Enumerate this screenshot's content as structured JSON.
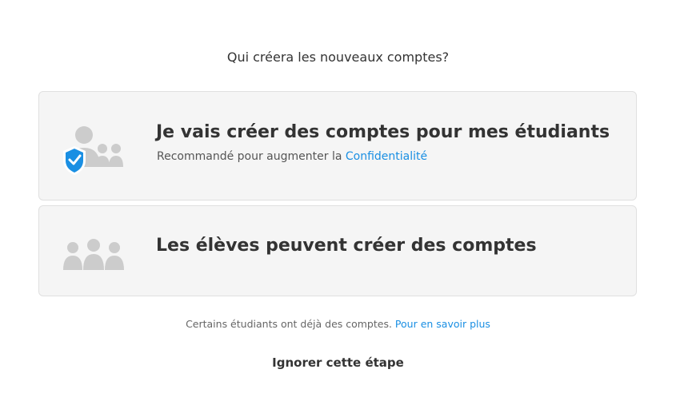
{
  "question": "Qui créera les nouveaux comptes?",
  "options": [
    {
      "title": "Je vais créer des comptes pour mes étudiants",
      "subtitle_prefix": "Recommandé pour augmenter la ",
      "subtitle_link": "Confidentialité",
      "icon": "teacher-with-shield-icon"
    },
    {
      "title": "Les élèves peuvent créer des comptes",
      "icon": "students-group-icon"
    }
  ],
  "footnote": {
    "text": "Certains étudiants ont déjà des comptes. ",
    "link": "Pour en savoir plus"
  },
  "skip_label": "Ignorer cette étape",
  "colors": {
    "card_background": "#f5f5f5",
    "link": "#1a8fe3",
    "shield": "#1a8fe3",
    "icon_gray": "#cccccc"
  }
}
